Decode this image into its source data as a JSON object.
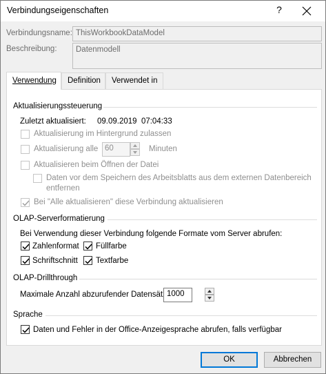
{
  "window": {
    "title": "Verbindungseigenschaften",
    "help_glyph": "?",
    "close_glyph": "✕"
  },
  "connection": {
    "name_label": "Verbindungsname:",
    "name_value": "ThisWorkbookDataModel",
    "description_label": "Beschreibung:",
    "description_value": "Datenmodell"
  },
  "tabs": [
    {
      "label": "Verwendung",
      "active": true
    },
    {
      "label": "Definition",
      "active": false
    },
    {
      "label": "Verwendet in",
      "active": false
    }
  ],
  "refresh": {
    "heading": "Aktualisierungssteuerung",
    "last_refreshed_label": "Zuletzt aktualisiert:",
    "last_refreshed_value": "09.09.2019  07:04:33",
    "background_label": "Aktualisierung im Hintergrund zulassen",
    "every_label": "Aktualisierung alle",
    "every_value": "60",
    "minutes_label": "Minuten",
    "on_open_label": "Aktualisieren beim Öffnen der Datei",
    "remove_data_line1": "Daten vor dem Speichern des Arbeitsblatts aus dem externen Datenbereich",
    "remove_data_line2": "entfernen",
    "refresh_all_label": "Bei \"Alle aktualisieren\" diese Verbindung aktualisieren"
  },
  "olap_format": {
    "heading": "OLAP-Serverformatierung",
    "intro": "Bei Verwendung dieser Verbindung folgende Formate vom Server abrufen:",
    "number_format": "Zahlenformat",
    "fill_color": "Füllfarbe",
    "font_style": "Schriftschnitt",
    "text_color": "Textfarbe"
  },
  "olap_drill": {
    "heading": "OLAP-Drillthrough",
    "max_records_label": "Maximale Anzahl abzurufender Datensätze:",
    "max_records_value": "1000"
  },
  "language": {
    "heading": "Sprache",
    "office_language_label": "Daten und Fehler in der Office-Anzeigesprache abrufen, falls verfügbar"
  },
  "buttons": {
    "ok": "OK",
    "cancel": "Abbrechen"
  },
  "colors": {
    "accent": "#0078d7",
    "panel": "#ffffff",
    "dialog": "#f0f0f0",
    "disabled_text": "#8f8f8f"
  }
}
